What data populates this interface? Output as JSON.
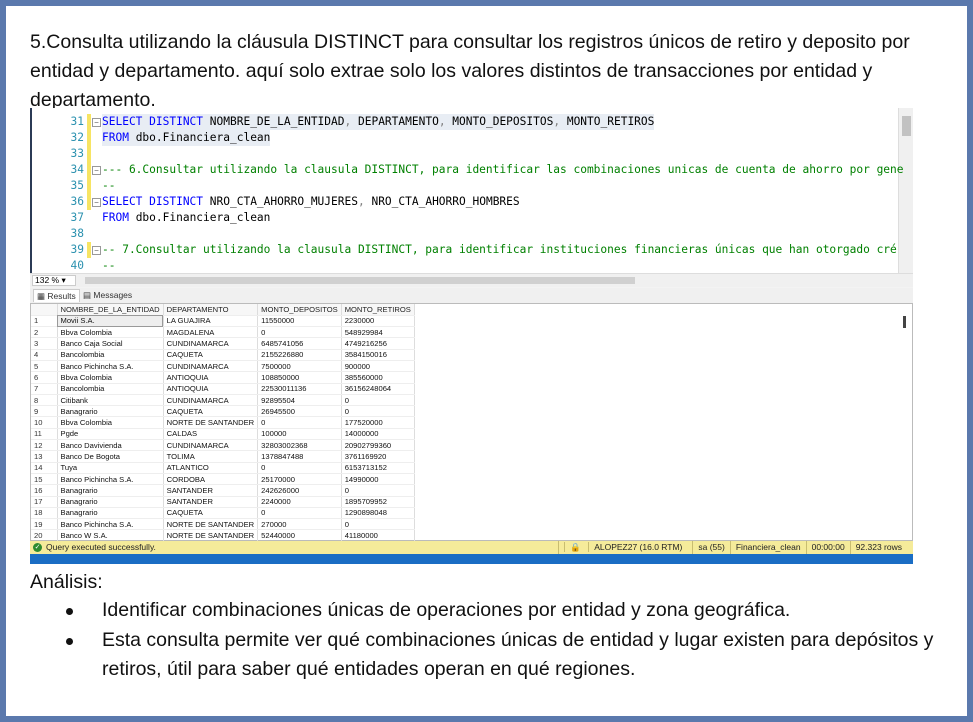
{
  "intro": "5.Consulta utilizando la cláusula DISTINCT para consultar los registros únicos de retiro y deposito por entidad y departamento. aquí solo extrae solo los valores distintos de transacciones por entidad y departamento.",
  "editor": {
    "lines": [
      {
        "n": "31",
        "parts": [
          [
            "kw",
            "SELECT DISTINCT "
          ],
          [
            "",
            "NOMBRE_DE_LA_ENTIDAD"
          ],
          [
            "pun",
            ", "
          ],
          [
            "",
            "DEPARTAMENTO"
          ],
          [
            "pun",
            ", "
          ],
          [
            "",
            "MONTO_DEPOSITOS"
          ],
          [
            "pun",
            ", "
          ],
          [
            "",
            "MONTO_RETIROS"
          ]
        ],
        "fold": true,
        "mark": true,
        "hl": true
      },
      {
        "n": "32",
        "parts": [
          [
            "kw",
            "FROM "
          ],
          [
            "",
            "dbo.Financiera_clean"
          ]
        ],
        "mark": true,
        "hl": true
      },
      {
        "n": "33",
        "parts": [],
        "mark": true
      },
      {
        "n": "34",
        "parts": [
          [
            "cm",
            "--- 6.Consultar utilizando la clausula DISTINCT, para identificar las combinaciones unicas de cuenta de ahorro por gene"
          ]
        ],
        "fold": true,
        "mark": true
      },
      {
        "n": "35",
        "parts": [
          [
            "cm",
            "--"
          ]
        ],
        "mark": true
      },
      {
        "n": "36",
        "parts": [
          [
            "kw",
            "SELECT DISTINCT "
          ],
          [
            "",
            "NRO_CTA_AHORRO_MUJERES"
          ],
          [
            "pun",
            ", "
          ],
          [
            "",
            "NRO_CTA_AHORRO_HOMBRES"
          ]
        ],
        "fold": true,
        "mark": true
      },
      {
        "n": "37",
        "parts": [
          [
            "kw",
            "FROM "
          ],
          [
            "",
            "dbo.Financiera_clean"
          ]
        ]
      },
      {
        "n": "38",
        "parts": []
      },
      {
        "n": "39",
        "parts": [
          [
            "cm",
            "--  7.Consultar utilizando la clausula DISTINCT, para identificar instituciones financieras únicas que han otorgado cré"
          ]
        ],
        "fold": true,
        "mark": true
      },
      {
        "n": "40",
        "parts": [
          [
            "cm",
            "--"
          ]
        ]
      }
    ],
    "zoom": "132 %"
  },
  "tabs": {
    "results": "Results",
    "messages": "Messages"
  },
  "grid": {
    "columns": [
      "NOMBRE_DE_LA_ENTIDAD",
      "DEPARTAMENTO",
      "MONTO_DEPOSITOS",
      "MONTO_RETIROS"
    ],
    "rows": [
      [
        "1",
        "Movii S.A.",
        "LA GUAJIRA",
        "11550000",
        "2230000"
      ],
      [
        "2",
        "Bbva Colombia",
        "MAGDALENA",
        "0",
        "548929984"
      ],
      [
        "3",
        "Banco Caja Social",
        "CUNDINAMARCA",
        "6485741056",
        "4749216256"
      ],
      [
        "4",
        "Bancolombia",
        "CAQUETA",
        "2155226880",
        "3584150016"
      ],
      [
        "5",
        "Banco Pichincha S.A.",
        "CUNDINAMARCA",
        "7500000",
        "900000"
      ],
      [
        "6",
        "Bbva Colombia",
        "ANTIOQUIA",
        "108850000",
        "385560000"
      ],
      [
        "7",
        "Bancolombia",
        "ANTIOQUIA",
        "22530011136",
        "36156248064"
      ],
      [
        "8",
        "Citibank",
        "CUNDINAMARCA",
        "92895504",
        "0"
      ],
      [
        "9",
        "Banagrario",
        "CAQUETA",
        "26945500",
        "0"
      ],
      [
        "10",
        "Bbva Colombia",
        "NORTE DE SANTANDER",
        "0",
        "177520000"
      ],
      [
        "11",
        "Pgde",
        "CALDAS",
        "100000",
        "14000000"
      ],
      [
        "12",
        "Banco Davivienda",
        "CUNDINAMARCA",
        "32803002368",
        "20902799360"
      ],
      [
        "13",
        "Banco De Bogota",
        "TOLIMA",
        "1378847488",
        "3761169920"
      ],
      [
        "14",
        "Tuya",
        "ATLANTICO",
        "0",
        "6153713152"
      ],
      [
        "15",
        "Banco Pichincha S.A.",
        "CORDOBA",
        "25170000",
        "14990000"
      ],
      [
        "16",
        "Banagrario",
        "SANTANDER",
        "242626000",
        "0"
      ],
      [
        "17",
        "Banagrario",
        "SANTANDER",
        "2240000",
        "1895709952"
      ],
      [
        "18",
        "Banagrario",
        "CAQUETA",
        "0",
        "1290898048"
      ],
      [
        "19",
        "Banco Pichincha S.A.",
        "NORTE DE SANTANDER",
        "270000",
        "0"
      ],
      [
        "20",
        "Banco W S.A.",
        "NORTE DE SANTANDER",
        "52440000",
        "41180000"
      ]
    ]
  },
  "status": {
    "message": "Query executed successfully.",
    "server": "ALOPEZ27 (16.0 RTM)",
    "user": "sa (55)",
    "database": "Financiera_clean",
    "time": "00:00:00",
    "rows": "92.323 rows",
    "color": "#f5eb9a"
  },
  "analysis": {
    "title": "Análisis:",
    "bullets": [
      "Identificar combinaciones únicas de operaciones por entidad y zona geográfica.",
      "Esta consulta permite ver qué combinaciones únicas de entidad y lugar existen para depósitos y retiros, útil para saber qué entidades operan en qué regiones."
    ]
  }
}
